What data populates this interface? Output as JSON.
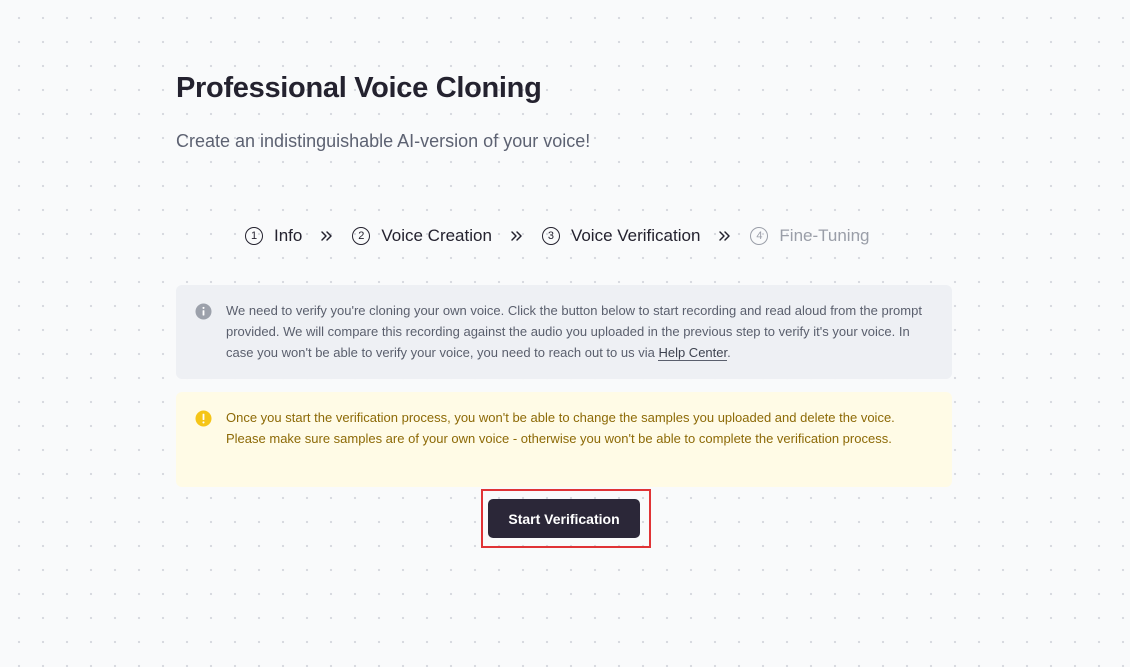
{
  "header": {
    "title": "Professional Voice Cloning",
    "subtitle": "Create an indistinguishable AI-version of your voice!"
  },
  "stepper": {
    "steps": [
      {
        "number": "1",
        "label": "Info",
        "state": "done"
      },
      {
        "number": "2",
        "label": "Voice Creation",
        "state": "done"
      },
      {
        "number": "3",
        "label": "Voice Verification",
        "state": "current"
      },
      {
        "number": "4",
        "label": "Fine-Tuning",
        "state": "upcoming"
      }
    ],
    "separator_icon": "double-chevron-right-icon"
  },
  "info_notice": {
    "icon": "info-icon",
    "text": "We need to verify you're cloning your own voice. Click the button below to start recording and read aloud from the prompt provided. We will compare this recording against the audio you uploaded in the previous step to verify it's your voice. In case you won't be able to verify your voice, you need to reach out to us via ",
    "link_text": "Help Center",
    "text_end": "."
  },
  "warning_notice": {
    "icon": "exclamation-icon",
    "text": "Once you start the verification process, you won't be able to change the samples you uploaded and delete the voice. Please make sure samples are of your own voice - otherwise you won't be able to complete the verification process."
  },
  "actions": {
    "start_verification_label": "Start Verification"
  },
  "colors": {
    "primary_button": "#2b2738",
    "info_background": "#eef0f4",
    "warning_background": "#fffbe6",
    "warning_icon": "#f5c518",
    "highlight_frame": "#e03336"
  }
}
